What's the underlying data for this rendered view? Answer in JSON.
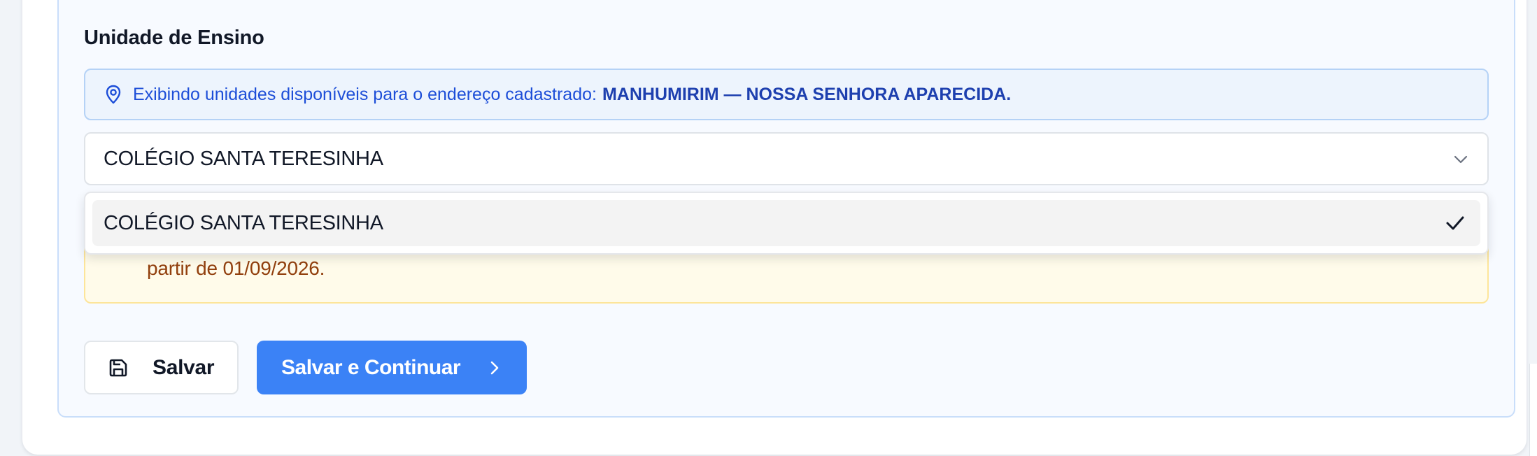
{
  "section": {
    "title": "Unidade de Ensino"
  },
  "info_banner": {
    "icon": "map-pin-icon",
    "text": "Exibindo unidades disponíveis para o endereço cadastrado:",
    "location": "MANHUMIRIM — NOSSA SENHORA APARECIDA."
  },
  "unit_select": {
    "selected_value": "COLÉGIO SANTA TERESINHA",
    "icon": "chevron-down-icon"
  },
  "dropdown": {
    "options": [
      {
        "label": "COLÉGIO SANTA TERESINHA",
        "selected": true,
        "icon": "check-icon"
      }
    ]
  },
  "warning": {
    "visible_text": "partir de 01/09/2026."
  },
  "actions": {
    "save_label": "Salvar",
    "save_icon": "save-disk-icon",
    "save_continue_label": "Salvar e Continuar",
    "save_continue_icon": "chevron-right-icon"
  },
  "colors": {
    "primary": "#3b82f6",
    "info_text": "#1d4ed8",
    "warning_text": "#92400e"
  }
}
